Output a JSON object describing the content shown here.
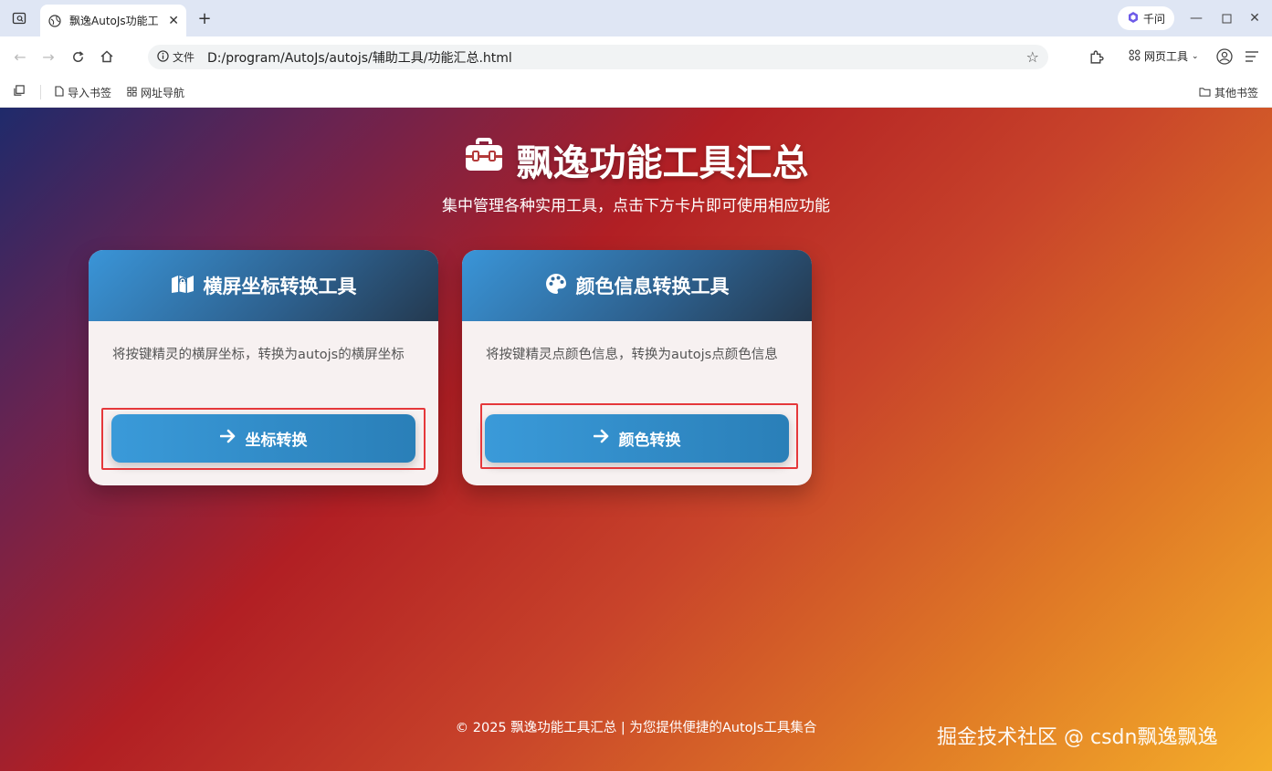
{
  "browser": {
    "tab_title": "飘逸AutoJs功能工",
    "tab_close": "✕",
    "new_tab": "+",
    "assistant_label": "千问",
    "url_scheme_label": "文件",
    "url": "D:/program/AutoJs/autojs/辅助工具/功能汇总.html",
    "web_tools_label": "网页工具",
    "bookmarks": {
      "import": "导入书签",
      "nav": "网址导航",
      "other": "其他书签"
    }
  },
  "page": {
    "title": "飘逸功能工具汇总",
    "subtitle": "集中管理各种实用工具，点击下方卡片即可使用相应功能",
    "cards": [
      {
        "title": "横屏坐标转换工具",
        "description": "将按键精灵的横屏坐标，转换为autojs的横屏坐标",
        "button": "坐标转换",
        "icon": "map-icon"
      },
      {
        "title": "颜色信息转换工具",
        "description": "将按键精灵点颜色信息，转换为autojs点颜色信息",
        "button": "颜色转换",
        "icon": "palette-icon"
      }
    ],
    "footer": "© 2025 飘逸功能工具汇总 | 为您提供便捷的AutoJs工具集合",
    "watermark": "掘金技术社区 @ csdn飘逸飘逸"
  },
  "colors": {
    "card_header_start": "#3a95d8",
    "card_header_end": "#24394f",
    "button": "#2a7fb8",
    "highlight_box": "#e5383b"
  }
}
